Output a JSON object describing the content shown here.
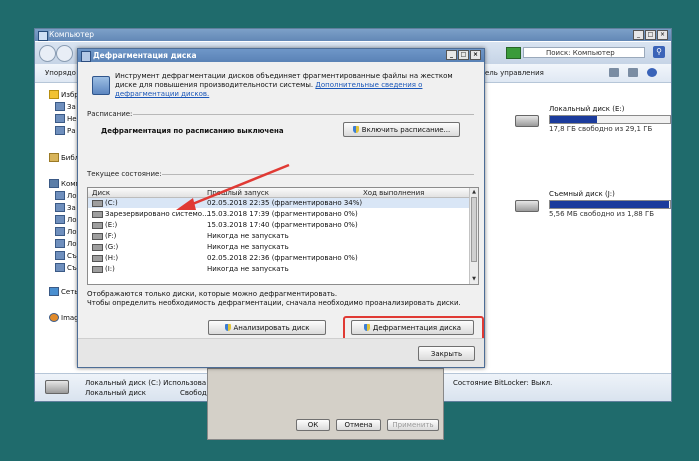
{
  "explorer": {
    "title": "Компьютер",
    "search_placeholder": "Поиск: Компьютер",
    "toolbar_left": "Упорядо",
    "toolbar_mid": "ель управления",
    "sidebar": [
      "Избр",
      "За",
      "Не",
      "Ра",
      "Библ",
      "Комп",
      "Ло",
      "За",
      "Ло",
      "Ло",
      "Ло",
      "Съ",
      "Съ",
      "Сеть",
      "Imag"
    ],
    "disk_e": {
      "name": "Локальный диск (E:)",
      "free": "17,8 ГБ свободно из 29,1 ГБ",
      "used_fraction": 0.39
    },
    "disk_j": {
      "name": "Съемный диск (J:)",
      "free": "5,56 МБ свободно из 1,88 ГБ",
      "used_fraction": 0.99
    },
    "details": {
      "name": "Локальный диск (C:) Использова",
      "type": "Локальный диск",
      "free_label": "Свободно",
      "bitlocker": "Состояние BitLocker: Выкл."
    }
  },
  "props_dialog": {
    "ok": "ОК",
    "cancel": "Отмена",
    "apply": "Применить"
  },
  "defrag": {
    "title": "Дефрагментация диска",
    "intro": "Инструмент дефрагментации дисков объединяет фрагментированные файлы на жестком диске для повышения производительности системы.",
    "intro_link": "Дополнительные сведения о дефрагментации дисков.",
    "schedule_label": "Расписание:",
    "schedule_status": "Дефрагментация по расписанию выключена",
    "enable_schedule": "Включить расписание...",
    "current_state_label": "Текущее состояние:",
    "columns": [
      "Диск",
      "Прошлый запуск",
      "Ход выполнения"
    ],
    "rows": [
      {
        "disk": "(C:)",
        "last": "02.05.2018 22:35 (фрагментировано 34%)"
      },
      {
        "disk": "Зарезервировано системо...",
        "last": "15.03.2018 17:39 (фрагментировано 0%)"
      },
      {
        "disk": "(E:)",
        "last": "15.03.2018 17:40 (фрагментировано 0%)"
      },
      {
        "disk": "(F:)",
        "last": "Никогда не запускать"
      },
      {
        "disk": "(G:)",
        "last": "Никогда не запускать"
      },
      {
        "disk": "(H:)",
        "last": "02.05.2018 22:36 (фрагментировано 0%)"
      },
      {
        "disk": "(I:)",
        "last": "Никогда не запускать"
      }
    ],
    "note1": "Отображаются только диски, которые можно дефрагментировать.",
    "note2": "Чтобы определить необходимость дефрагментации, сначала необходимо проанализировать диски.",
    "analyze": "Анализировать диск",
    "defragment": "Дефрагментация диска",
    "close": "Закрыть"
  },
  "colors": {
    "highlight": "#e03a34",
    "arrow": "#e03a34",
    "fill": "#1b3b9c"
  }
}
